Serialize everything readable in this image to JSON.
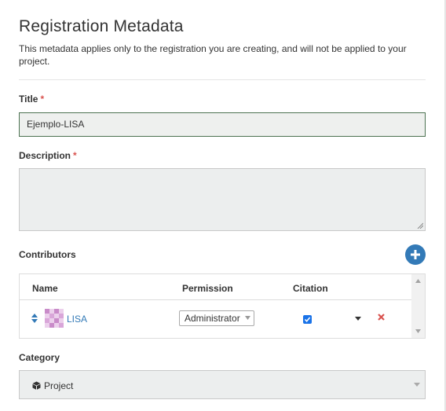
{
  "header": {
    "title": "Registration Metadata",
    "subtitle": "This metadata applies only to the registration you are creating, and will not be applied to your project."
  },
  "form": {
    "title_label": "Title",
    "title_value": "Ejemplo-LISA",
    "required_mark": "*",
    "description_label": "Description",
    "description_value": "",
    "contributors_label": "Contributors",
    "category_label": "Category",
    "category_value": "Project"
  },
  "contributors": {
    "columns": [
      "Name",
      "Permission",
      "Citation"
    ],
    "rows": [
      {
        "name": "LISA",
        "permission": "Administrator",
        "citation": true
      }
    ]
  },
  "icons": {
    "add": "plus-circle-icon",
    "sort": "sort-icon",
    "remove": "remove-icon",
    "category": "cube-icon"
  },
  "colors": {
    "accent": "#337ab7",
    "required": "#d9534f",
    "remove": "#d9534f",
    "title_border": "#4b7150"
  }
}
